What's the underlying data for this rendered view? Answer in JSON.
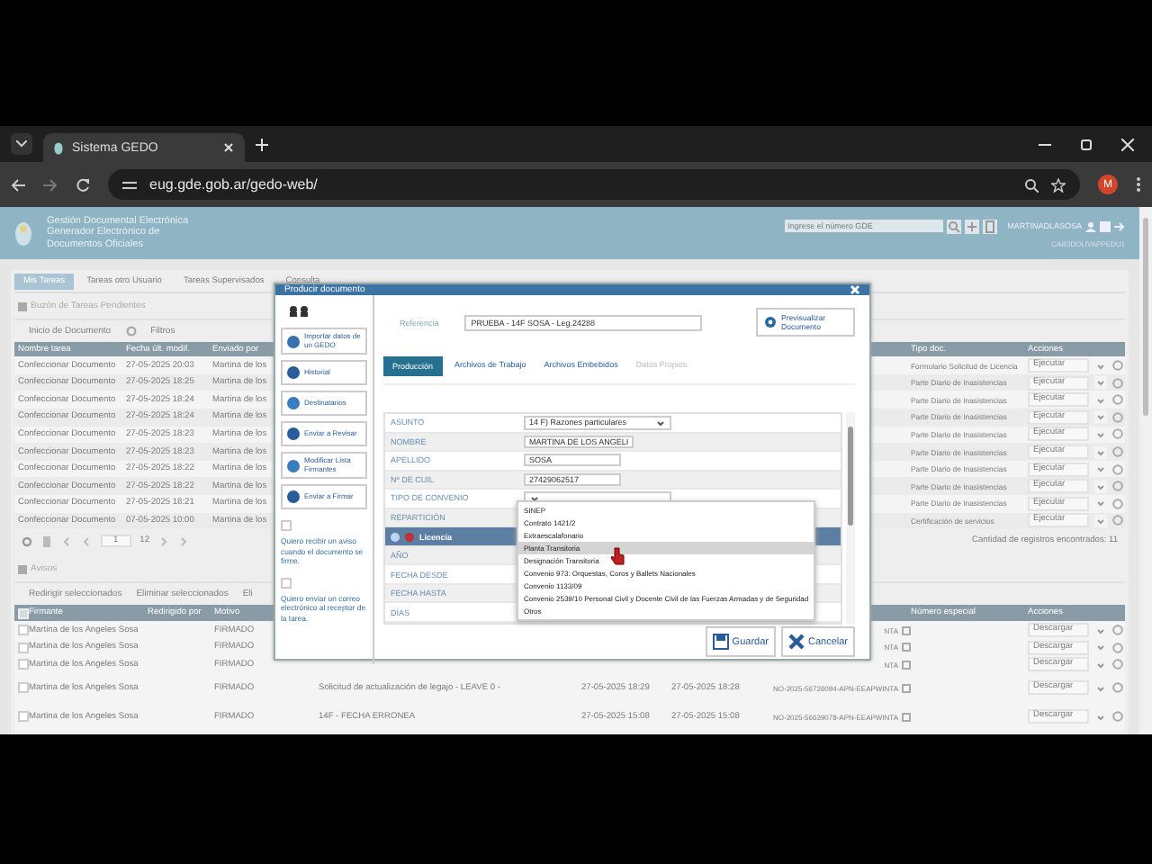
{
  "browser": {
    "tab_title": "Sistema GEDO",
    "url": "eug.gde.gob.ar/gedo-web/",
    "avatar": "M"
  },
  "header": {
    "title_lines": [
      "Gestión Documental Electrónica",
      "Generador Electrónico de",
      "Documentos Oficiales"
    ],
    "search_placeholder": "Ingrese el número GDE",
    "user": "MARTINADLASOSA",
    "user_sub": "CAB3DOLIVAPPEDU1"
  },
  "tabs": [
    {
      "label": "Mis Tareas",
      "selected": true
    },
    {
      "label": "Tareas otro Usuario",
      "selected": false
    },
    {
      "label": "Tareas Supervisados",
      "selected": false
    },
    {
      "label": "Consulta",
      "selected": false
    }
  ],
  "tasks": {
    "title": "Buzón de Tareas Pendientes",
    "start_button": "Inicio de Documento",
    "filter_button": "Filtros",
    "columns": [
      "Nombre tarea",
      "Fecha últ. modif.",
      "Enviado por",
      "Tipo doc.",
      "Acciones"
    ],
    "rows": [
      {
        "name": "Confeccionar Documento",
        "date": "27-05-2025 20:03",
        "sender": "Martina de los",
        "type": "Formulario Solicitud de Licencia",
        "action": "Ejecutar"
      },
      {
        "name": "Confeccionar Documento",
        "date": "27-05-2025 18:25",
        "sender": "Martina de los",
        "type": "Parte Diario de Inasistencias",
        "action": "Ejecutar"
      },
      {
        "name": "Confeccionar Documento",
        "date": "27-05-2025 18:24",
        "sender": "Martina de los",
        "type": "Parte Diario de Inasistencias",
        "action": "Ejecutar"
      },
      {
        "name": "Confeccionar Documento",
        "date": "27-05-2025 18:24",
        "sender": "Martina de los",
        "type": "Parte Diario de Inasistencias",
        "action": "Ejecutar"
      },
      {
        "name": "Confeccionar Documento",
        "date": "27-05-2025 18:23",
        "sender": "Martina de los",
        "type": "Parte Diario de Inasistencias",
        "action": "Ejecutar"
      },
      {
        "name": "Confeccionar Documento",
        "date": "27-05-2025 18:23",
        "sender": "Martina de los",
        "type": "Parte Diario de Inasistencias",
        "action": "Ejecutar"
      },
      {
        "name": "Confeccionar Documento",
        "date": "27-05-2025 18:22",
        "sender": "Martina de los",
        "type": "Parte Diario de Inasistencias",
        "action": "Ejecutar"
      },
      {
        "name": "Confeccionar Documento",
        "date": "27-05-2025 18:22",
        "sender": "Martina de los",
        "type": "Parte Diario de Inasistencias",
        "action": "Ejecutar"
      },
      {
        "name": "Confeccionar Documento",
        "date": "27-05-2025 18:21",
        "sender": "Martina de los",
        "type": "Parte Diario de Inasistencias",
        "action": "Ejecutar"
      },
      {
        "name": "Confeccionar Documento",
        "date": "07-05-2025 10:00",
        "sender": "Martina de los",
        "type": "Certificación de servicios",
        "action": "Ejecutar"
      }
    ],
    "page": "1",
    "pages": "12",
    "count": "Cantidad de registros encontrados: 11"
  },
  "avisos": {
    "title": "Avisos",
    "all_checked": false,
    "actions": [
      "Redirigir seleccionados",
      "Eliminar seleccionados",
      "Eli"
    ],
    "columns": [
      "Firmante",
      "Redirigido por",
      "Motivo",
      "Número especial",
      "Acciones"
    ],
    "rows": [
      {
        "checked": false,
        "signer": "Martina de los Angeles Sosa",
        "reason": "FIRMADO",
        "number": "NTA",
        "action": "Descargar"
      },
      {
        "checked": false,
        "signer": "Martina de los Angeles Sosa",
        "reason": "FIRMADO",
        "number": "NTA",
        "action": "Descargar"
      },
      {
        "checked": false,
        "signer": "Martina de los Angeles Sosa",
        "reason": "FIRMADO",
        "number": "NTA",
        "action": "Descargar"
      },
      {
        "checked": false,
        "signer": "Martina de los Angeles Sosa",
        "reason": "FIRMADO",
        "reference": "Solicitud de actualización de legajo - LEAVE 0 -",
        "date1": "27-05-2025 18:29",
        "date2": "27-05-2025 18:28",
        "number": "NO-2025-56726094-APN-EEAPWINTA",
        "action": "Descargar"
      },
      {
        "checked": false,
        "signer": "Martina de los Angeles Sosa",
        "reason": "FIRMADO",
        "reference": "14F - FECHA ERRONEA",
        "date1": "27-05-2025 15:08",
        "date2": "27-05-2025 15:08",
        "number": "NO-2025-56639078-APN-EEAPWINTA",
        "action": "Descargar"
      }
    ]
  },
  "modal": {
    "title": "Producir documento",
    "side_buttons": [
      {
        "kind": "import",
        "label": "Importar datos de un GEDO"
      },
      {
        "kind": "history",
        "label": "Historial"
      },
      {
        "kind": "recipients",
        "label": "Destinatarios"
      },
      {
        "kind": "review",
        "label": "Enviar a Revisar"
      },
      {
        "kind": "signers",
        "label": "Modificar Lista Firmantes"
      },
      {
        "kind": "sign",
        "label": "Enviar a Firmar"
      }
    ],
    "options": [
      {
        "label": "Quiero recibir un aviso cuando el documento se firme.",
        "checked": false
      },
      {
        "label": "Quiero enviar un correo electrónico al receptor de la tarea.",
        "checked": false
      }
    ],
    "reference_label": "Referencia",
    "reference": "PRUEBA - 14F SOSA - Leg.24288",
    "preview_button": "Previsualizar Documento",
    "tabs": [
      {
        "label": "Producción",
        "selected": true,
        "disabled": false
      },
      {
        "label": "Archivos de Trabajo",
        "selected": false,
        "disabled": false
      },
      {
        "label": "Archivos Embebidos",
        "selected": false,
        "disabled": false
      },
      {
        "label": "Datos Propios",
        "selected": false,
        "disabled": true
      }
    ],
    "fields": [
      {
        "kind": "select",
        "label": "ASUNTO",
        "value": "14 F) Razones particulares"
      },
      {
        "kind": "text",
        "label": "NOMBRE",
        "value": "MARTINA DE LOS ANGELI"
      },
      {
        "kind": "text",
        "label": "APELLIDO",
        "value": "SOSA"
      },
      {
        "kind": "text",
        "label": "Nº DE CUIL",
        "value": "27429062517"
      },
      {
        "kind": "select",
        "label": "TIPO DE CONVENIO"
      },
      {
        "kind": "text",
        "label": "REPARTICIÓN"
      },
      {
        "kind": "section",
        "label": "Licencia"
      },
      {
        "kind": "text",
        "label": "AÑO"
      },
      {
        "kind": "text",
        "label": "FECHA DESDE"
      },
      {
        "kind": "text",
        "label": "FECHA HASTA"
      },
      {
        "kind": "text",
        "label": "DÍAS"
      }
    ],
    "dropdown": [
      {
        "label": "SINEP",
        "selected": false
      },
      {
        "label": "Contrato 1421/2",
        "selected": false
      },
      {
        "label": "Extraescalafonario",
        "selected": false
      },
      {
        "label": "Planta Transitoria",
        "selected": true
      },
      {
        "label": "Designación Transitoria",
        "selected": false
      },
      {
        "label": "Convenio 973: Orquestas, Coros y Ballets Nacionales",
        "selected": false
      },
      {
        "label": "Convenio 1133/09",
        "selected": false
      },
      {
        "label": "Convenio 2539/10 Personal Civil y Docente Civil de las Fuerzas Armadas y de Seguridad",
        "selected": false
      },
      {
        "label": "Otros",
        "selected": false
      }
    ],
    "save_button": "Guardar",
    "cancel_button": "Cancelar"
  }
}
